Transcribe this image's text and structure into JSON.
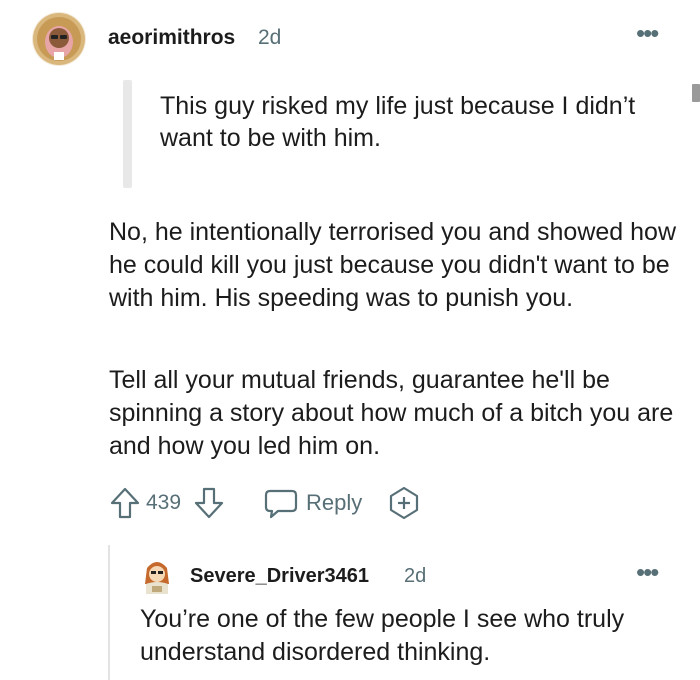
{
  "comment": {
    "author": "aeorimithros",
    "age": "2d",
    "more_glyph": "•••",
    "quote": "This guy risked my life just because I didn’t want to be with him.",
    "paragraphs": [
      "No, he intentionally terrorised you and showed how he could kill you just because you didn't want to be with him. His speeding was to punish you.",
      "Tell all your mutual friends, guarantee he'll be spinning a story about how much of a bitch you are and how you led him on."
    ],
    "score": "439",
    "reply_label": "Reply",
    "icons": [
      "upvote-icon",
      "downvote-icon",
      "speech-bubble-icon",
      "award-plus-icon",
      "more-options-icon"
    ]
  },
  "reply": {
    "author": "Severe_Driver3461",
    "age": "2d",
    "more_glyph": "•••",
    "body": "You’re one of the few people I see who truly understand disordered thinking."
  },
  "colors": {
    "meta": "#576f76",
    "text": "#1c1c1c",
    "quote_bar": "#e8e8e8"
  }
}
